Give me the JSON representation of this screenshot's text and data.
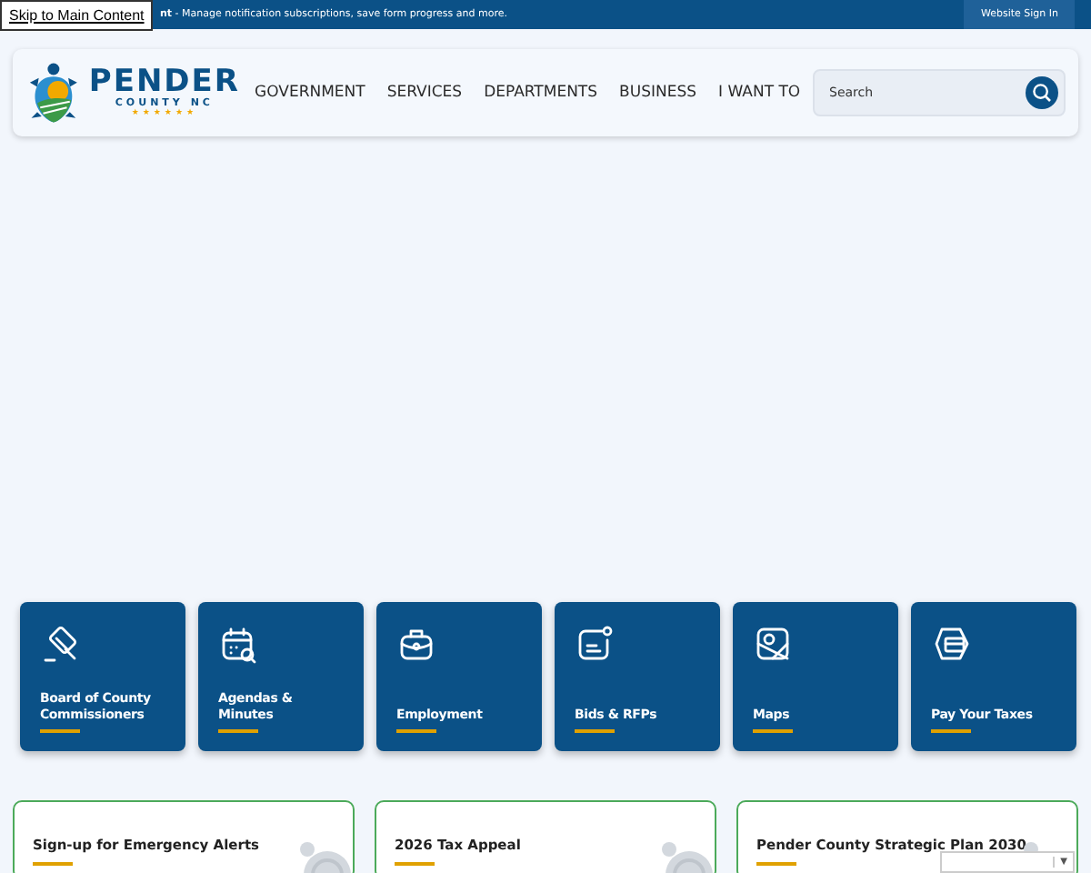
{
  "skip_link": "Skip to Main Content",
  "top_bar": {
    "message": "**nt** - Manage notification subscriptions, save form progress and more.",
    "sign_in": "Website Sign In"
  },
  "logo": {
    "name": "PENDER",
    "subtitle": "COUNTY NC",
    "stars": "★★★★★★"
  },
  "nav": [
    "GOVERNMENT",
    "SERVICES",
    "DEPARTMENTS",
    "BUSINESS",
    "I WANT TO"
  ],
  "search": {
    "placeholder": "Search"
  },
  "tiles": [
    {
      "kind": "gavel",
      "label": "Board of County Commissioners"
    },
    {
      "kind": "calendar",
      "label": "Agendas & Minutes"
    },
    {
      "kind": "briefcase",
      "label": "Employment"
    },
    {
      "kind": "notice",
      "label": "Bids & RFPs"
    },
    {
      "kind": "map",
      "label": "Maps"
    },
    {
      "kind": "card",
      "label": "Pay Your Taxes"
    }
  ],
  "links": [
    "Sign-up for Emergency Alerts",
    "2026 Tax Appeal",
    "Pender County Strategic Plan 2030"
  ],
  "language_select": {
    "arrow": "▼"
  }
}
